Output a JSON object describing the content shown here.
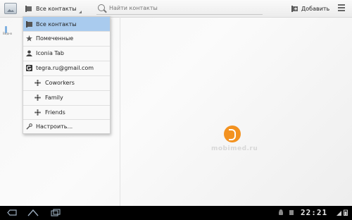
{
  "actionbar": {
    "filter_label": "Все контакты",
    "search_placeholder": "Найти контакты",
    "add_label": "Добавить"
  },
  "list_pane": {
    "tiny_label": "Видно"
  },
  "dropdown": {
    "items": [
      {
        "label": "Все контакты",
        "icon": "contacts-icon",
        "selected": true
      },
      {
        "label": "Помеченные",
        "icon": "star-icon"
      },
      {
        "label": "Iconia Tab",
        "icon": "person-icon"
      },
      {
        "label": "tegra.ru@gmail.com",
        "icon": "google-account-icon"
      },
      {
        "label": "Coworkers",
        "icon": "group-icon"
      },
      {
        "label": "Family",
        "icon": "group-icon"
      },
      {
        "label": "Friends",
        "icon": "group-icon"
      },
      {
        "label": "Настроить...",
        "icon": "wrench-icon"
      }
    ]
  },
  "watermark": {
    "text": "mobimed.ru",
    "color": "#f39220"
  },
  "systembar": {
    "time": "22:21"
  },
  "colors": {
    "selected": "#a9cbee",
    "accent": "#7fb0e0"
  }
}
